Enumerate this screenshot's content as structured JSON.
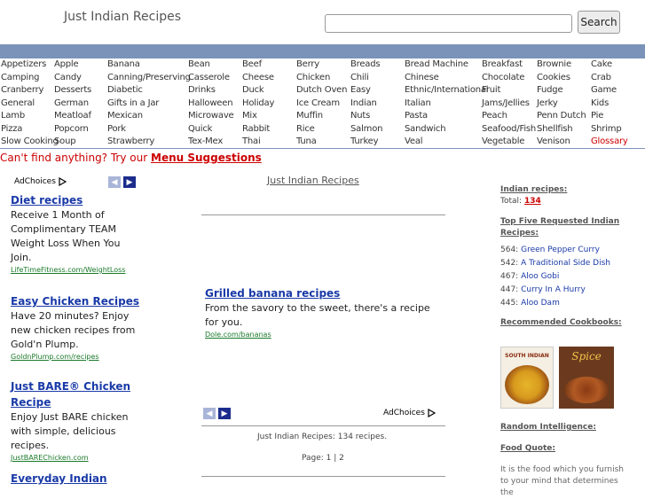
{
  "header": {
    "site_title": "Just Indian Recipes",
    "search_placeholder": "",
    "search_button": "Search"
  },
  "categories": [
    [
      "Appetizers",
      "Apple",
      "Banana",
      "Bean",
      "Beef",
      "Berry",
      "Breads",
      "Bread Machine",
      "Breakfast",
      "Brownie",
      "Cake"
    ],
    [
      "Camping",
      "Candy",
      "Canning/Preserving",
      "Casserole",
      "Cheese",
      "Chicken",
      "Chili",
      "Chinese",
      "Chocolate",
      "Cookies",
      "Crab"
    ],
    [
      "Cranberry",
      "Desserts",
      "Diabetic",
      "Drinks",
      "Duck",
      "Dutch Oven",
      "Easy",
      "Ethnic/International",
      "Fruit",
      "Fudge",
      "Game"
    ],
    [
      "General",
      "German",
      "Gifts in a Jar",
      "Halloween",
      "Holiday",
      "Ice Cream",
      "Indian",
      "Italian",
      "Jams/Jellies",
      "Jerky",
      "Kids"
    ],
    [
      "Lamb",
      "Meatloaf",
      "Mexican",
      "Microwave",
      "Mix",
      "Muffin",
      "Nuts",
      "Pasta",
      "Peach",
      "Penn Dutch",
      "Pie"
    ],
    [
      "Pizza",
      "Popcorn",
      "Pork",
      "Quick",
      "Rabbit",
      "Rice",
      "Salmon",
      "Sandwich",
      "Seafood/Fish",
      "Shellfish",
      "Shrimp"
    ],
    [
      "Slow Cooking",
      "Soup",
      "Strawberry",
      "Tex-Mex",
      "Thai",
      "Tuna",
      "Turkey",
      "Veal",
      "Vegetable",
      "Venison",
      "Glossary"
    ]
  ],
  "menu_suggest": {
    "prefix": "Can't find anything? Try our",
    "link": "Menu Suggestions"
  },
  "left_ads": {
    "adchoices": "AdChoices",
    "items": [
      {
        "title": "Diet recipes",
        "body": "Receive 1 Month of Complimentary TEAM Weight Loss When You Join.",
        "url": "LifeTimeFitness.com/WeightLoss"
      },
      {
        "title": "Easy Chicken Recipes",
        "body": "Have 20 minutes? Enjoy new chicken recipes from Gold'n Plump.",
        "url": "GoldnPlump.com/recipes"
      },
      {
        "title": "Just BARE® Chicken Recipe",
        "body": "Enjoy Just BARE chicken with simple, delicious recipes.",
        "url": "JustBAREChicken.com"
      },
      {
        "title": "Everyday Indian",
        "body": "",
        "url": ""
      }
    ]
  },
  "center": {
    "title": "Just Indian Recipes",
    "ad": {
      "title": "Grilled banana recipes",
      "body": "From the savory to the sweet, there's a recipe for you.",
      "url": "Dole.com/bananas"
    },
    "adchoices": "AdChoices",
    "count_text": "Just Indian Recipes: 134 recipes.",
    "page_text": "Page: 1 | 2"
  },
  "right": {
    "indian_heading": "Indian recipes:",
    "total_label": "Total:",
    "total_value": "134",
    "top_heading": "Top Five Requested Indian Recipes:",
    "top_items": [
      {
        "count": "564:",
        "name": "Green Pepper Curry"
      },
      {
        "count": "542:",
        "name": "A Traditional Side Dish"
      },
      {
        "count": "467:",
        "name": "Aloo Gobi"
      },
      {
        "count": "447:",
        "name": "Curry In A Hurry"
      },
      {
        "count": "445:",
        "name": "Aloo Dam"
      }
    ],
    "cookbooks_heading": "Recommended Cookbooks:",
    "book1_title": "SOUTH INDIAN",
    "book2_title": "Spice",
    "random_heading": "Random Intelligence:",
    "quote_heading": "Food Quote:",
    "quote_text": "It is the food which you furnish to your mind that determines the"
  },
  "colors": {
    "nav": "#7b93b9",
    "link": "#1a3aa8",
    "red": "#cc0000",
    "url_green": "#1a7a2a"
  }
}
